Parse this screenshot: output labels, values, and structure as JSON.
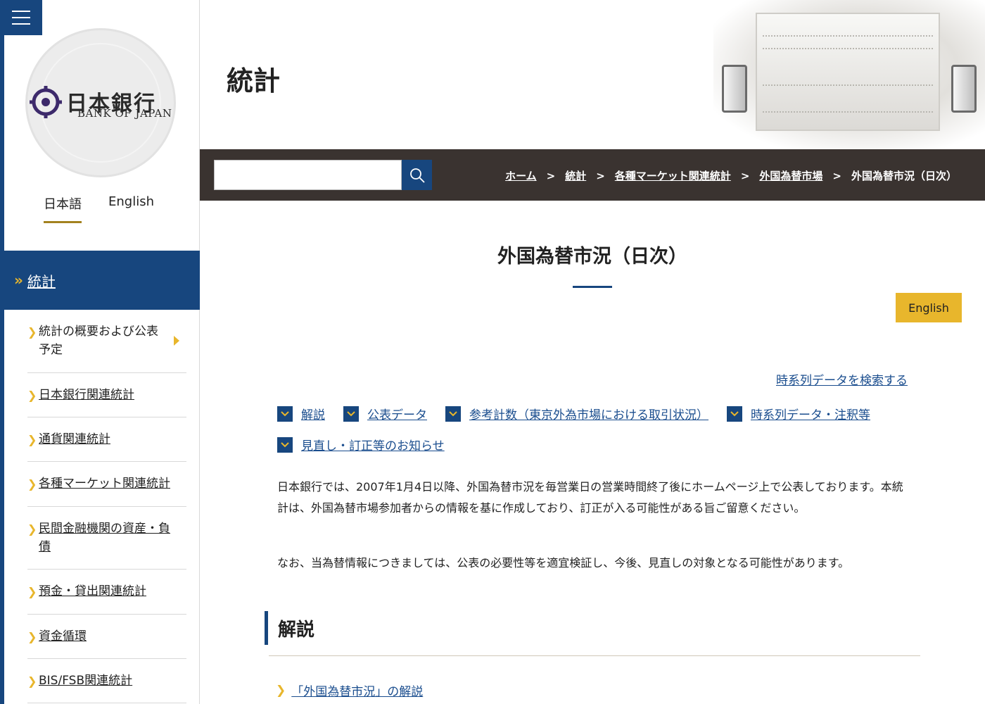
{
  "sidebar": {
    "logo_name": "日本銀行",
    "logo_sub": "BANK OF JAPAN",
    "languages": [
      {
        "label": "日本語"
      },
      {
        "label": "English"
      }
    ],
    "section": "統計",
    "items": [
      {
        "label": "統計の概要および公表予定"
      },
      {
        "label": "日本銀行関連統計"
      },
      {
        "label": "通貨関連統計"
      },
      {
        "label": "各種マーケット関連統計"
      },
      {
        "label": "民間金融機関の資産・負債"
      },
      {
        "label": "預金・貸出関連統計"
      },
      {
        "label": "資金循環"
      },
      {
        "label": "BIS/FSB関連統計"
      }
    ]
  },
  "header": {
    "title": "統計"
  },
  "search": {
    "placeholder": ""
  },
  "breadcrumb": [
    {
      "label": "ホーム"
    },
    {
      "label": "統計"
    },
    {
      "label": "各種マーケット関連統計"
    },
    {
      "label": "外国為替市場"
    },
    {
      "label": "外国為替市況（日次）"
    }
  ],
  "breadcrumb_sep": ">",
  "main": {
    "title": "外国為替市況（日次）",
    "english_button": "English",
    "timeseries_link": "時系列データを検索する",
    "anchors_row1": [
      {
        "label": "解説"
      },
      {
        "label": "公表データ"
      },
      {
        "label": "参考計数（東京外為市場における取引状況）"
      },
      {
        "label": "時系列データ・注釈等"
      }
    ],
    "anchors_row2": [
      {
        "label": "見直し・訂正等のお知らせ"
      }
    ],
    "paragraph1": "日本銀行では、2007年1月4日以降、外国為替市況を毎営業日の営業時間終了後にホームページ上で公表しております。本統計は、外国為替市場参加者からの情報を基に作成しており、訂正が入る可能性がある旨ご留意ください。",
    "paragraph2": "なお、当為替情報につきましては、公表の必要性等を適宜検証し、今後、見直しの対象となる可能性があります。",
    "section_heading": "解説",
    "doc_link": "「外国為替市況」の解説"
  },
  "colors": {
    "primary": "#17467e",
    "accent": "#e8b62c",
    "toolbar": "#3a3330",
    "link": "#1a4d8e"
  }
}
